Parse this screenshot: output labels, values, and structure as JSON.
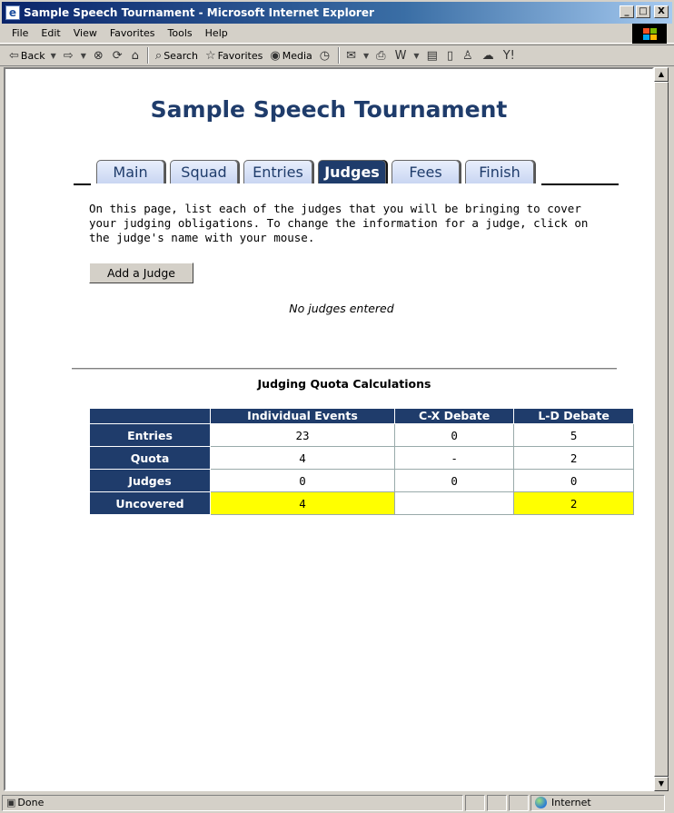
{
  "window": {
    "title": "Sample Speech Tournament - Microsoft Internet Explorer",
    "buttons": {
      "minimize": "_",
      "maximize": "□",
      "close": "X"
    }
  },
  "menubar": [
    "File",
    "Edit",
    "View",
    "Favorites",
    "Tools",
    "Help"
  ],
  "toolbar": {
    "back": "Back",
    "search": "Search",
    "favorites": "Favorites",
    "media": "Media"
  },
  "page": {
    "title": "Sample Speech Tournament",
    "tabs": [
      {
        "label": "Main",
        "active": false
      },
      {
        "label": "Squad",
        "active": false
      },
      {
        "label": "Entries",
        "active": false
      },
      {
        "label": "Judges",
        "active": true
      },
      {
        "label": "Fees",
        "active": false
      },
      {
        "label": "Finish",
        "active": false
      }
    ],
    "intro": "On this page, list each of the judges that you will be bringing to cover your judging obligations. To change the information for a judge, click on the judge's name with your mouse.",
    "add_button": "Add a Judge",
    "no_judges": "No judges entered",
    "quota_title": "Judging Quota Calculations",
    "quota_table": {
      "columns": [
        "",
        "Individual Events",
        "C-X Debate",
        "L-D Debate"
      ],
      "rows": [
        {
          "label": "Entries",
          "values": [
            "23",
            "0",
            "5"
          ]
        },
        {
          "label": "Quota",
          "values": [
            "4",
            "-",
            "2"
          ]
        },
        {
          "label": "Judges",
          "values": [
            "0",
            "0",
            "0"
          ]
        },
        {
          "label": "Uncovered",
          "values": [
            "4",
            "",
            "2"
          ]
        }
      ]
    }
  },
  "statusbar": {
    "status": "Done",
    "zone": "Internet"
  },
  "colors": {
    "accent": "#1f3c6b",
    "highlight": "#ffff00"
  }
}
